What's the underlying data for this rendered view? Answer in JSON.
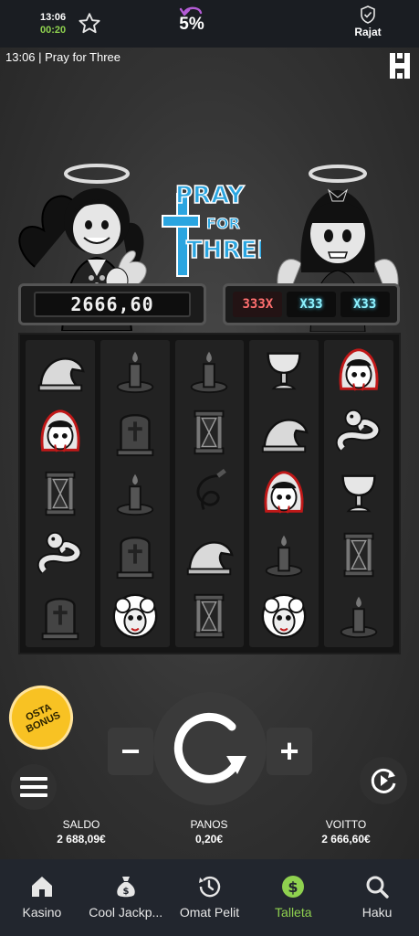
{
  "status_bar": {
    "clock": "13:06",
    "session_time": "00:20",
    "return_percent": "5%",
    "limits_label": "Rajat"
  },
  "game": {
    "title": "13:06  |  Pray for Three",
    "logo_text": [
      "PRAY",
      "FOR",
      "THREE"
    ],
    "win_amount": "2666,60",
    "multipliers": [
      "333X",
      "X33",
      "X33"
    ],
    "reels": [
      [
        "crow",
        "maid",
        "hourglass",
        "snake",
        "tombstone"
      ],
      [
        "candle",
        "tombstone",
        "candle",
        "tombstone",
        "lamb"
      ],
      [
        "candle",
        "hourglass",
        "whip",
        "crow",
        "hourglass"
      ],
      [
        "chalice",
        "crow",
        "maid",
        "candle",
        "lamb"
      ],
      [
        "maid",
        "snake",
        "chalice",
        "hourglass",
        "candle"
      ]
    ],
    "buy_bonus_label": "OSTA BONUS",
    "minus_label": "−",
    "plus_label": "+"
  },
  "stats": {
    "balance_label": "SALDO",
    "balance_value": "2 688,09€",
    "bet_label": "PANOS",
    "bet_value": "0,20€",
    "win_label": "VOITTO",
    "win_value": "2 666,60€"
  },
  "bottom_nav": [
    {
      "label": "Kasino",
      "icon": "home-icon"
    },
    {
      "label": "Cool Jackp...",
      "icon": "moneybag-icon"
    },
    {
      "label": "Omat Pelit",
      "icon": "history-icon"
    },
    {
      "label": "Talleta",
      "icon": "dollar-icon"
    },
    {
      "label": "Haku",
      "icon": "search-icon"
    }
  ],
  "colors": {
    "accent_green": "#8fd14f",
    "buy_bonus_yellow": "#f8c223",
    "logo_blue": "#2aa5e0",
    "multiplier_red": "#ff6f6f",
    "multiplier_cyan": "#8ff3ff"
  }
}
